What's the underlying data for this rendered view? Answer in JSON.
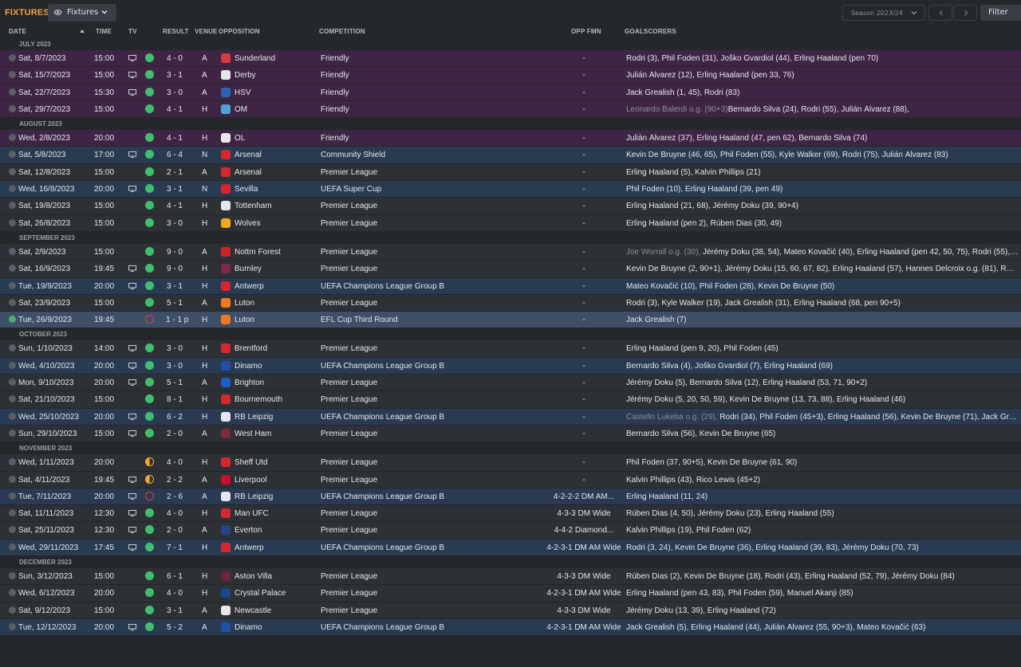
{
  "header": {
    "title": "FIXTURES",
    "view_dropdown": "Fixtures",
    "season": "Season 2023/24",
    "filter_label": "Filter"
  },
  "columns": {
    "date": "DATE",
    "time": "TIME",
    "tv": "TV",
    "result": "RESULT",
    "venue": "VENUE",
    "opposition": "OPPOSITION",
    "competition": "COMPETITION",
    "opp_fmn": "OPP FMN",
    "goalscorers": "GOALSCORERS"
  },
  "months": [
    {
      "label": "JULY 2023",
      "rows": [
        {
          "date": "Sat, 8/7/2023",
          "time": "15:00",
          "tv": true,
          "result": "W",
          "score": "4 - 0",
          "venue": "A",
          "opp": "Sunderland",
          "crest": "#d93a3a",
          "comp": "Friendly",
          "type": "friendly",
          "fmn": "-",
          "goals": "Rodri (3), Phil Foden (31), Joško Gvardiol (44), Erling Haaland (pen 70)",
          "og": ""
        },
        {
          "date": "Sat, 15/7/2023",
          "time": "15:00",
          "tv": true,
          "result": "W",
          "score": "3 - 1",
          "venue": "A",
          "opp": "Derby",
          "crest": "#e6e6e6",
          "comp": "Friendly",
          "type": "friendly",
          "fmn": "-",
          "goals": "Julián Álvarez (12), Erling Haaland (pen 33, 76)",
          "og": ""
        },
        {
          "date": "Sat, 22/7/2023",
          "time": "15:30",
          "tv": true,
          "result": "W",
          "score": "3 - 0",
          "venue": "A",
          "opp": "HSV",
          "crest": "#2a62b8",
          "comp": "Friendly",
          "type": "friendly",
          "fmn": "-",
          "goals": "Jack Grealish (1, 45), Rodri (83)",
          "og": ""
        },
        {
          "date": "Sat, 29/7/2023",
          "time": "15:00",
          "tv": false,
          "result": "W",
          "score": "4 - 1",
          "venue": "H",
          "opp": "OM",
          "crest": "#4fa3d9",
          "comp": "Friendly",
          "type": "friendly",
          "fmn": "-",
          "goals": "Bernardo Silva (24), Rodri (55), Julián Álvarez (88), ",
          "og": "Leonardo Balerdi o.g. (90+3)"
        }
      ]
    },
    {
      "label": "AUGUST 2023",
      "rows": [
        {
          "date": "Wed, 2/8/2023",
          "time": "20:00",
          "tv": false,
          "result": "W",
          "score": "4 - 1",
          "venue": "H",
          "opp": "OL",
          "crest": "#e9e9ef",
          "comp": "Friendly",
          "type": "friendly",
          "fmn": "-",
          "goals": "Julián Álvarez (37), Erling Haaland (47, pen 62), Bernardo Silva (74)",
          "og": ""
        },
        {
          "date": "Sat, 5/8/2023",
          "time": "17:00",
          "tv": true,
          "result": "W",
          "score": "6 - 4",
          "venue": "N",
          "opp": "Arsenal",
          "crest": "#d8262e",
          "comp": "Community Shield",
          "type": "cup",
          "fmn": "-",
          "goals": "Kevin De Bruyne (46, 65), Phil Foden (55), Kyle Walker (69), Rodri (75), Julián Álvarez (83)",
          "og": ""
        },
        {
          "date": "Sat, 12/8/2023",
          "time": "15:00",
          "tv": false,
          "result": "W",
          "score": "2 - 1",
          "venue": "A",
          "opp": "Arsenal",
          "crest": "#d8262e",
          "comp": "Premier League",
          "type": "league",
          "fmn": "-",
          "goals": "Erling Haaland (5), Kalvin Phillips (21)",
          "og": ""
        },
        {
          "date": "Wed, 16/8/2023",
          "time": "20:00",
          "tv": true,
          "result": "W",
          "score": "3 - 1",
          "venue": "N",
          "opp": "Sevilla",
          "crest": "#d8262e",
          "comp": "UEFA Super Cup",
          "type": "cup",
          "fmn": "-",
          "goals": "Phil Foden (10), Erling Haaland (39, pen 49)",
          "og": ""
        },
        {
          "date": "Sat, 19/8/2023",
          "time": "15:00",
          "tv": false,
          "result": "W",
          "score": "4 - 1",
          "venue": "H",
          "opp": "Tottenham",
          "crest": "#e6e8ee",
          "comp": "Premier League",
          "type": "league",
          "fmn": "-",
          "goals": "Erling Haaland (21, 68), Jérémy Doku (39, 90+4)",
          "og": ""
        },
        {
          "date": "Sat, 26/8/2023",
          "time": "15:00",
          "tv": false,
          "result": "W",
          "score": "3 - 0",
          "venue": "H",
          "opp": "Wolves",
          "crest": "#f3a81d",
          "comp": "Premier League",
          "type": "league",
          "fmn": "-",
          "goals": "Erling Haaland (pen 2), Rúben Dias (30, 49)",
          "og": ""
        }
      ]
    },
    {
      "label": "SEPTEMBER 2023",
      "rows": [
        {
          "date": "Sat, 2/9/2023",
          "time": "15:00",
          "tv": false,
          "result": "W",
          "score": "9 - 0",
          "venue": "A",
          "opp": "Nottm Forest",
          "crest": "#d3212a",
          "comp": "Premier League",
          "type": "league",
          "fmn": "-",
          "goals": "Jérémy Doku (38, 54), Mateo Kovačić (40), Erling Haaland (pen 42, 50, 75), Rodri (55), Ke...",
          "og": "Joe Worrall o.g. (30), "
        },
        {
          "date": "Sat, 16/9/2023",
          "time": "19:45",
          "tv": true,
          "result": "W",
          "score": "9 - 0",
          "venue": "H",
          "opp": "Burnley",
          "crest": "#7a2a4a",
          "comp": "Premier League",
          "type": "league",
          "fmn": "-",
          "goals": "Kevin De Bruyne (2, 90+1), Jérémy Doku (15, 60, 67, 82), Erling Haaland (57), Hannes Delcroix o.g. (81), Rúben...",
          "og": ""
        },
        {
          "date": "Tue, 19/9/2023",
          "time": "20:00",
          "tv": true,
          "result": "W",
          "score": "3 - 1",
          "venue": "H",
          "opp": "Antwerp",
          "crest": "#d8262e",
          "comp": "UEFA Champions League Group B",
          "type": "cup",
          "fmn": "-",
          "goals": "Mateo Kovačić (10), Phil Foden (28), Kevin De Bruyne (50)",
          "og": ""
        },
        {
          "date": "Sat, 23/9/2023",
          "time": "15:00",
          "tv": false,
          "result": "W",
          "score": "5 - 1",
          "venue": "A",
          "opp": "Luton",
          "crest": "#f07a22",
          "comp": "Premier League",
          "type": "league",
          "fmn": "-",
          "goals": "Rodri (3), Kyle Walker (19), Jack Grealish (31), Erling Haaland (68, pen 90+5)",
          "og": ""
        },
        {
          "date": "Tue, 26/9/2023",
          "time": "19:45",
          "tv": false,
          "result": "L",
          "score": "1 - 1 p",
          "venue": "H",
          "opp": "Luton",
          "crest": "#f07a22",
          "comp": "EFL Cup Third Round",
          "type": "sel",
          "fmn": "-",
          "goals": "Jack Grealish (7)",
          "og": ""
        }
      ]
    },
    {
      "label": "OCTOBER 2023",
      "rows": [
        {
          "date": "Sun, 1/10/2023",
          "time": "14:00",
          "tv": true,
          "result": "W",
          "score": "3 - 0",
          "venue": "H",
          "opp": "Brentford",
          "crest": "#d8262e",
          "comp": "Premier League",
          "type": "league",
          "fmn": "-",
          "goals": "Erling Haaland (pen 9, 20), Phil Foden (45)",
          "og": ""
        },
        {
          "date": "Wed, 4/10/2023",
          "time": "20:00",
          "tv": true,
          "result": "W",
          "score": "3 - 0",
          "venue": "H",
          "opp": "Dinamo",
          "crest": "#1f4fa8",
          "comp": "UEFA Champions League Group B",
          "type": "cup",
          "fmn": "-",
          "goals": "Bernardo Silva (4), Joško Gvardiol (7), Erling Haaland (69)",
          "og": ""
        },
        {
          "date": "Mon, 9/10/2023",
          "time": "20:00",
          "tv": true,
          "result": "W",
          "score": "5 - 1",
          "venue": "A",
          "opp": "Brighton",
          "crest": "#1b5ec6",
          "comp": "Premier League",
          "type": "league",
          "fmn": "-",
          "goals": "Jérémy Doku (5), Bernardo Silva (12), Erling Haaland (53, 71, 90+2)",
          "og": ""
        },
        {
          "date": "Sat, 21/10/2023",
          "time": "15:00",
          "tv": false,
          "result": "W",
          "score": "8 - 1",
          "venue": "H",
          "opp": "Bournemouth",
          "crest": "#d8262e",
          "comp": "Premier League",
          "type": "league",
          "fmn": "-",
          "goals": "Jérémy Doku (5, 20, 50, 59), Kevin De Bruyne (13, 73, 88), Erling Haaland (46)",
          "og": ""
        },
        {
          "date": "Wed, 25/10/2023",
          "time": "20:00",
          "tv": true,
          "result": "W",
          "score": "6 - 2",
          "venue": "H",
          "opp": "RB Leipzig",
          "crest": "#e6e6ee",
          "comp": "UEFA Champions League Group B",
          "type": "cup",
          "fmn": "-",
          "goals": "Rodri (34), Phil Foden (45+3), Erling Haaland (56), Kevin De Bruyne (71), Jack Grealis...",
          "og": "Castello Lukeba o.g. (29), "
        },
        {
          "date": "Sun, 29/10/2023",
          "time": "15:00",
          "tv": true,
          "result": "W",
          "score": "2 - 0",
          "venue": "A",
          "opp": "West Ham",
          "crest": "#7a2a3a",
          "comp": "Premier League",
          "type": "league",
          "fmn": "-",
          "goals": "Bernardo Silva (56), Kevin De Bruyne (65)",
          "og": ""
        }
      ]
    },
    {
      "label": "NOVEMBER 2023",
      "rows": [
        {
          "date": "Wed, 1/11/2023",
          "time": "20:00",
          "tv": false,
          "result": "D",
          "score": "4 - 0",
          "venue": "H",
          "opp": "Sheff Utd",
          "crest": "#d8262e",
          "comp": "Premier League",
          "type": "league",
          "fmn": "-",
          "goals": "Phil Foden (37, 90+5), Kevin De Bruyne (61, 90)",
          "og": ""
        },
        {
          "date": "Sat, 4/11/2023",
          "time": "19:45",
          "tv": true,
          "result": "D",
          "score": "2 - 2",
          "venue": "A",
          "opp": "Liverpool",
          "crest": "#c8102e",
          "comp": "Premier League",
          "type": "league",
          "fmn": "-",
          "goals": "Kalvin Phillips (43), Rico Lewis (45+2)",
          "og": ""
        },
        {
          "date": "Tue, 7/11/2023",
          "time": "20:00",
          "tv": true,
          "result": "L",
          "score": "2 - 6",
          "venue": "A",
          "opp": "RB Leipzig",
          "crest": "#e6e6ee",
          "comp": "UEFA Champions League Group B",
          "type": "cup",
          "fmn": "4-2-2-2 DM AM...",
          "goals": "Erling Haaland (11, 24)",
          "og": ""
        },
        {
          "date": "Sat, 11/11/2023",
          "time": "12:30",
          "tv": true,
          "result": "W",
          "score": "4 - 0",
          "venue": "H",
          "opp": "Man UFC",
          "crest": "#d8262e",
          "comp": "Premier League",
          "type": "league",
          "fmn": "4-3-3 DM Wide",
          "goals": "Rúben Dias (4, 50), Jérémy Doku (23), Erling Haaland (55)",
          "og": ""
        },
        {
          "date": "Sat, 25/11/2023",
          "time": "12:30",
          "tv": true,
          "result": "W",
          "score": "2 - 0",
          "venue": "A",
          "opp": "Everton",
          "crest": "#274488",
          "comp": "Premier League",
          "type": "league",
          "fmn": "4-4-2 Diamond...",
          "goals": "Kalvin Phillips (19), Phil Foden (62)",
          "og": ""
        },
        {
          "date": "Wed, 29/11/2023",
          "time": "17:45",
          "tv": true,
          "result": "W",
          "score": "7 - 1",
          "venue": "H",
          "opp": "Antwerp",
          "crest": "#d8262e",
          "comp": "UEFA Champions League Group B",
          "type": "cup",
          "fmn": "4-2-3-1 DM AM Wide",
          "goals": "Rodri (3, 24), Kevin De Bruyne (36), Erling Haaland (39, 83), Jérémy Doku (70, 73)",
          "og": ""
        }
      ]
    },
    {
      "label": "DECEMBER 2023",
      "rows": [
        {
          "date": "Sun, 3/12/2023",
          "time": "15:00",
          "tv": false,
          "result": "W",
          "score": "6 - 1",
          "venue": "H",
          "opp": "Aston Villa",
          "crest": "#6e2143",
          "comp": "Premier League",
          "type": "league",
          "fmn": "4-3-3 DM Wide",
          "goals": "Rúben Dias (2), Kevin De Bruyne (18), Rodri (43), Erling Haaland (52, 79), Jérémy Doku (84)",
          "og": ""
        },
        {
          "date": "Wed, 6/12/2023",
          "time": "20:00",
          "tv": false,
          "result": "W",
          "score": "4 - 0",
          "venue": "H",
          "opp": "Crystal Palace",
          "crest": "#1b458f",
          "comp": "Premier League",
          "type": "league",
          "fmn": "4-2-3-1 DM AM Wide",
          "goals": "Erling Haaland (pen 43, 83), Phil Foden (59), Manuel Akanji (85)",
          "og": ""
        },
        {
          "date": "Sat, 9/12/2023",
          "time": "15:00",
          "tv": false,
          "result": "W",
          "score": "3 - 1",
          "venue": "A",
          "opp": "Newcastle",
          "crest": "#e8e8e8",
          "comp": "Premier League",
          "type": "league",
          "fmn": "4-3-3 DM Wide",
          "goals": "Jérémy Doku (13, 39), Erling Haaland (72)",
          "og": ""
        },
        {
          "date": "Tue, 12/12/2023",
          "time": "20:00",
          "tv": true,
          "result": "W",
          "score": "5 - 2",
          "venue": "A",
          "opp": "Dinamo",
          "crest": "#1f4fa8",
          "comp": "UEFA Champions League Group B",
          "type": "cup",
          "fmn": "4-2-3-1 DM AM Wide",
          "goals": "Jack Grealish (5), Erling Haaland (44), Julián Álvarez (55, 90+3), Mateo Kovačić (63)",
          "og": ""
        }
      ]
    }
  ]
}
